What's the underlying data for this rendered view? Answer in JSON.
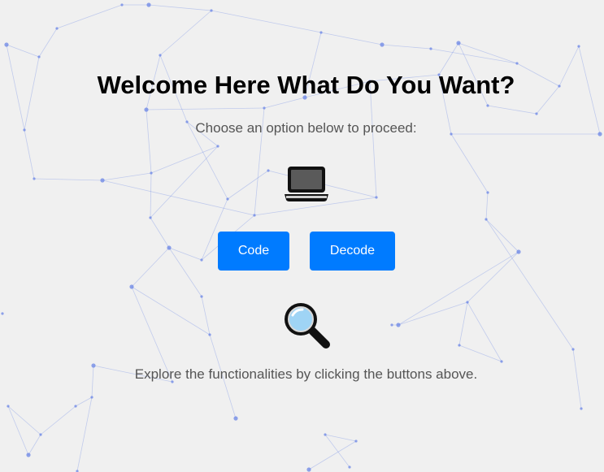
{
  "page": {
    "title": "Welcome Here What Do You Want?",
    "subtitle": "Choose an option below to proceed:",
    "footer": "Explore the functionalities by clicking the buttons above."
  },
  "buttons": {
    "code_label": "Code",
    "decode_label": "Decode"
  },
  "icons": {
    "top": "laptop-icon",
    "bottom": "magnifying-glass-icon"
  },
  "colors": {
    "background": "#f0f0f0",
    "button": "#007bff",
    "button_text": "#ffffff",
    "title": "#000000",
    "body_text": "#555555",
    "network": "#6b86e6"
  }
}
